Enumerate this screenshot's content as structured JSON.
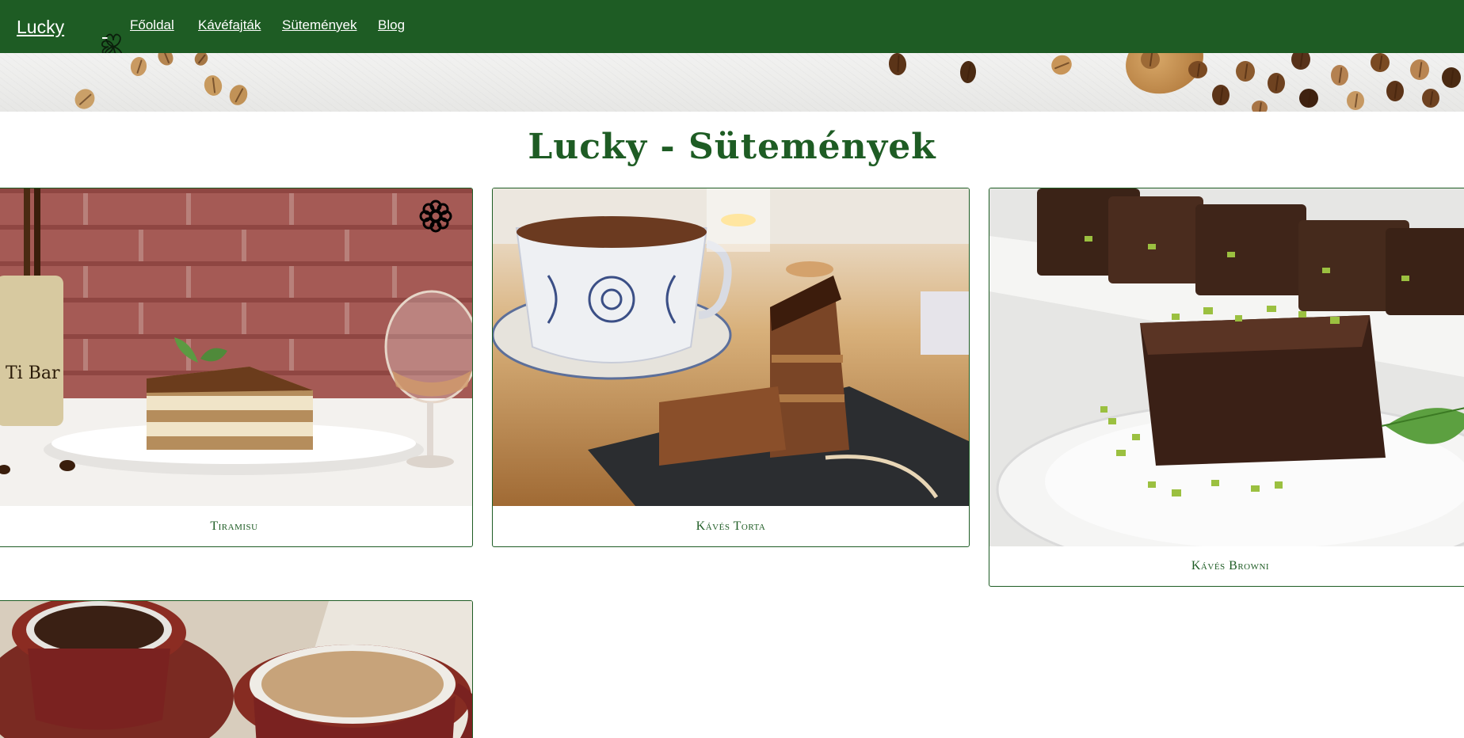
{
  "navbar": {
    "brand": "Lucky",
    "links": [
      "Főoldal",
      "Kávéfajták",
      "Sütemények",
      "Blog"
    ]
  },
  "icons": {
    "brand_logo": "clover-icon",
    "card_badge": "flower-icon"
  },
  "page": {
    "title": "Lucky - Sütemények"
  },
  "cards": [
    {
      "caption": "Tiramisu"
    },
    {
      "caption": "Kávés Torta"
    },
    {
      "caption": "Kávés Browni"
    }
  ],
  "colors": {
    "primary": "#1e5c24",
    "background": "#ffffff",
    "nav_text": "#ffffff"
  }
}
